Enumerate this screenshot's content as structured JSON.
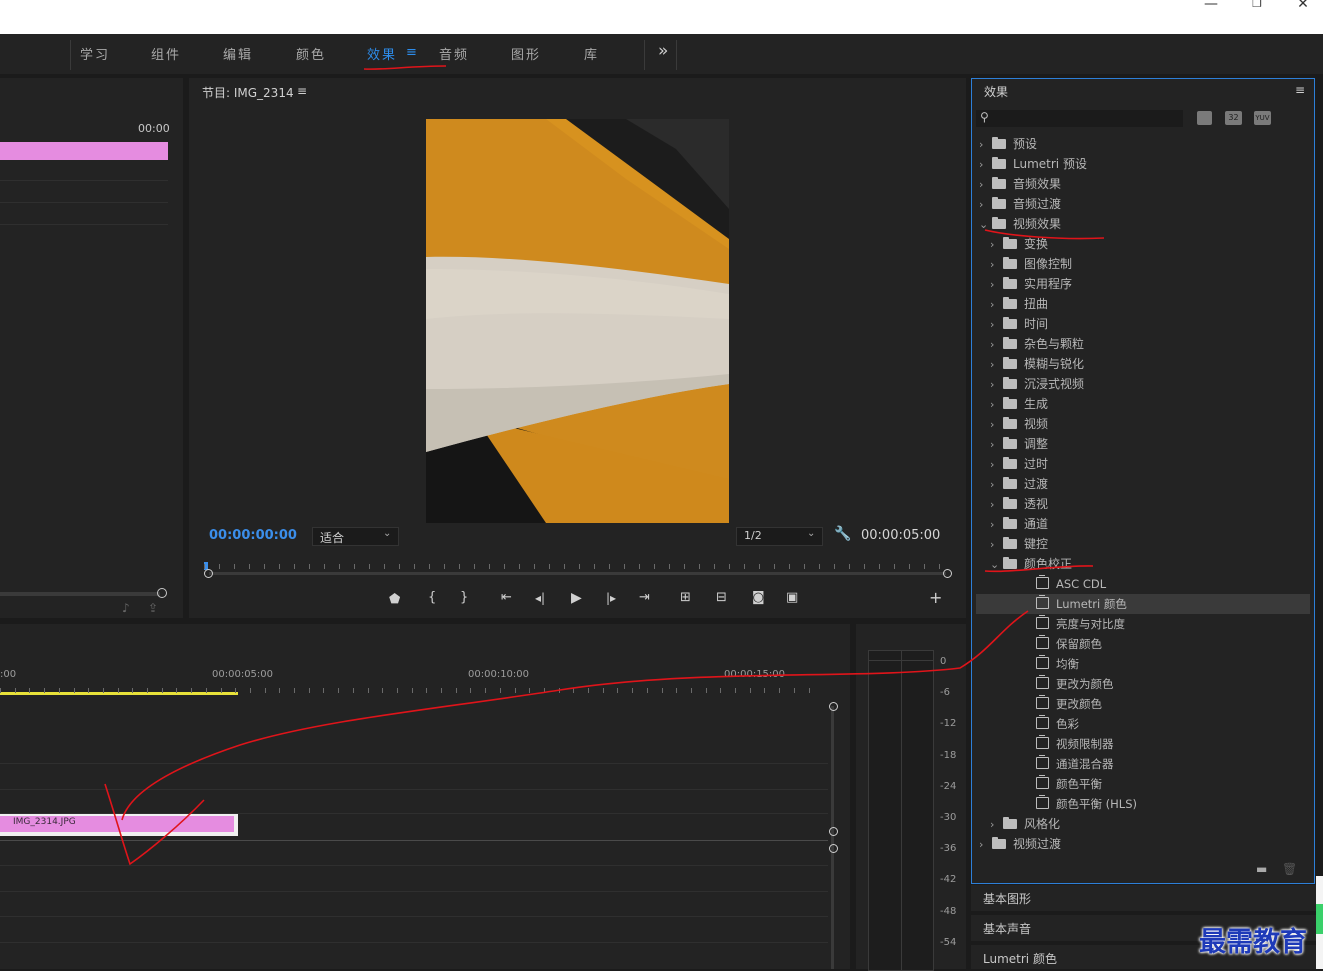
{
  "window": {
    "minimize": "—",
    "restore": "❐",
    "close": "✕"
  },
  "workspace_tabs": [
    {
      "label": "学习",
      "active": false
    },
    {
      "label": "组件",
      "active": false
    },
    {
      "label": "编辑",
      "active": false
    },
    {
      "label": "颜色",
      "active": false
    },
    {
      "label": "效果",
      "active": true
    },
    {
      "label": "音频",
      "active": false
    },
    {
      "label": "图形",
      "active": false
    },
    {
      "label": "库",
      "active": false
    }
  ],
  "workspace_more": "»",
  "workspace_menu_icon": "≡",
  "source_panel": {
    "timecode": "00:00"
  },
  "program": {
    "title": "节目: IMG_2314",
    "menu_icon": "≡",
    "timecode_current": "00:00:00:00",
    "fit_label": "适合",
    "resolution_label": "1/2",
    "timecode_duration": "00:00:05:00"
  },
  "transport_icons": [
    "marker-icon",
    "in-point-icon",
    "out-point-icon",
    "go-to-in-icon",
    "step-back-icon",
    "play-icon",
    "step-forward-icon",
    "go-to-out-icon",
    "lift-icon",
    "extract-icon",
    "export-frame-icon",
    "comparison-view-icon"
  ],
  "transport_glyphs": [
    "⬟",
    "{",
    "}",
    "⇤",
    "◂|",
    "▶",
    "|▸",
    "⇥",
    "⊞",
    "⊟",
    "◙",
    "▣"
  ],
  "timeline": {
    "ruler_labels": [
      ":00",
      "00:00:05:00",
      "00:00:10:00",
      "00:00:15:00"
    ],
    "clip_name": "IMG_2314.JPG",
    "meter_labels": [
      "0",
      "-6",
      "-12",
      "-18",
      "-24",
      "-30",
      "-36",
      "-42",
      "-48",
      "-54"
    ]
  },
  "effects_panel": {
    "title": "效果",
    "menu_icon": "≡",
    "badges": [
      "32",
      "YUV"
    ],
    "tree": [
      {
        "depth": 0,
        "chev": "›",
        "icon": "preset",
        "label": "预设",
        "selected": false
      },
      {
        "depth": 0,
        "chev": "›",
        "icon": "preset",
        "label": "Lumetri 预设",
        "selected": false
      },
      {
        "depth": 0,
        "chev": "›",
        "icon": "folder",
        "label": "音频效果",
        "selected": false
      },
      {
        "depth": 0,
        "chev": "›",
        "icon": "folder",
        "label": "音频过渡",
        "selected": false
      },
      {
        "depth": 0,
        "chev": "⌄",
        "icon": "folder",
        "label": "视频效果",
        "selected": false
      },
      {
        "depth": 1,
        "chev": "›",
        "icon": "folder",
        "label": "变换",
        "selected": false
      },
      {
        "depth": 1,
        "chev": "›",
        "icon": "folder",
        "label": "图像控制",
        "selected": false
      },
      {
        "depth": 1,
        "chev": "›",
        "icon": "folder",
        "label": "实用程序",
        "selected": false
      },
      {
        "depth": 1,
        "chev": "›",
        "icon": "folder",
        "label": "扭曲",
        "selected": false
      },
      {
        "depth": 1,
        "chev": "›",
        "icon": "folder",
        "label": "时间",
        "selected": false
      },
      {
        "depth": 1,
        "chev": "›",
        "icon": "folder",
        "label": "杂色与颗粒",
        "selected": false
      },
      {
        "depth": 1,
        "chev": "›",
        "icon": "folder",
        "label": "模糊与锐化",
        "selected": false
      },
      {
        "depth": 1,
        "chev": "›",
        "icon": "folder",
        "label": "沉浸式视频",
        "selected": false
      },
      {
        "depth": 1,
        "chev": "›",
        "icon": "folder",
        "label": "生成",
        "selected": false
      },
      {
        "depth": 1,
        "chev": "›",
        "icon": "folder",
        "label": "视频",
        "selected": false
      },
      {
        "depth": 1,
        "chev": "›",
        "icon": "folder",
        "label": "调整",
        "selected": false
      },
      {
        "depth": 1,
        "chev": "›",
        "icon": "folder",
        "label": "过时",
        "selected": false
      },
      {
        "depth": 1,
        "chev": "›",
        "icon": "folder",
        "label": "过渡",
        "selected": false
      },
      {
        "depth": 1,
        "chev": "›",
        "icon": "folder",
        "label": "透视",
        "selected": false
      },
      {
        "depth": 1,
        "chev": "›",
        "icon": "folder",
        "label": "通道",
        "selected": false
      },
      {
        "depth": 1,
        "chev": "›",
        "icon": "folder",
        "label": "键控",
        "selected": false
      },
      {
        "depth": 1,
        "chev": "⌄",
        "icon": "folder",
        "label": "颜色校正",
        "selected": false
      },
      {
        "depth": 2,
        "chev": "",
        "icon": "fx",
        "label": "ASC CDL",
        "selected": false
      },
      {
        "depth": 2,
        "chev": "",
        "icon": "fx",
        "label": "Lumetri 颜色",
        "selected": true
      },
      {
        "depth": 2,
        "chev": "",
        "icon": "fx",
        "label": "亮度与对比度",
        "selected": false
      },
      {
        "depth": 2,
        "chev": "",
        "icon": "fx",
        "label": "保留颜色",
        "selected": false
      },
      {
        "depth": 2,
        "chev": "",
        "icon": "fx",
        "label": "均衡",
        "selected": false
      },
      {
        "depth": 2,
        "chev": "",
        "icon": "fx",
        "label": "更改为颜色",
        "selected": false
      },
      {
        "depth": 2,
        "chev": "",
        "icon": "fx",
        "label": "更改颜色",
        "selected": false
      },
      {
        "depth": 2,
        "chev": "",
        "icon": "fx",
        "label": "色彩",
        "selected": false
      },
      {
        "depth": 2,
        "chev": "",
        "icon": "fx",
        "label": "视频限制器",
        "selected": false
      },
      {
        "depth": 2,
        "chev": "",
        "icon": "fx",
        "label": "通道混合器",
        "selected": false
      },
      {
        "depth": 2,
        "chev": "",
        "icon": "fx",
        "label": "颜色平衡",
        "selected": false
      },
      {
        "depth": 2,
        "chev": "",
        "icon": "fx",
        "label": "颜色平衡 (HLS)",
        "selected": false
      },
      {
        "depth": 1,
        "chev": "›",
        "icon": "folder",
        "label": "风格化",
        "selected": false
      },
      {
        "depth": 0,
        "chev": "›",
        "icon": "folder",
        "label": "视频过渡",
        "selected": false
      }
    ]
  },
  "side_panels": [
    "基本图形",
    "基本声音",
    "Lumetri 颜色"
  ],
  "watermark": "最需教育",
  "colors": {
    "accent": "#2d8ceb",
    "clip": "#e58ce0",
    "annotation": "#e0141a",
    "playhead_bar": "#e8e23a"
  }
}
